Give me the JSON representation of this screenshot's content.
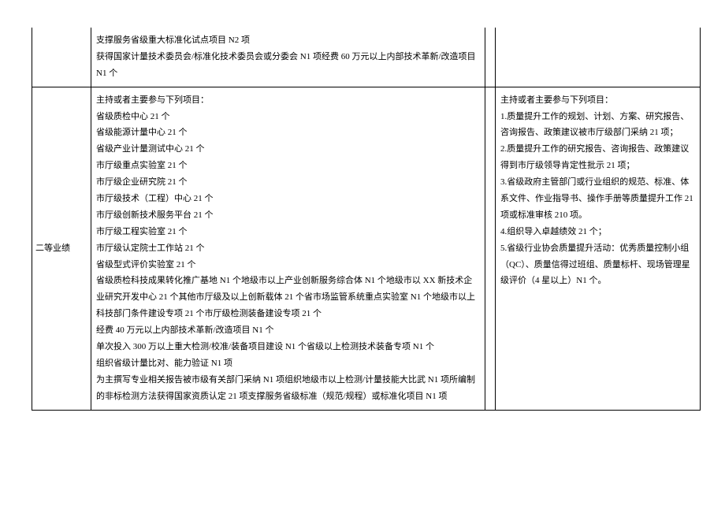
{
  "top_row": {
    "lines": [
      "支撑服务省级重大标准化试点项目 N2 项",
      "获得国家计量技术委员会/标准化技术委员会或分委会 N1 项经费 60 万元以上内部技术革新/改造项目N1 个"
    ]
  },
  "main_row": {
    "label": "二等业绩",
    "left_lines": [
      "主持或者主要参与下列项目：",
      "省级质检中心 21 个",
      "省级能源计量中心 21 个",
      "省级产业计量测试中心 21 个",
      "市厅级重点实验室 21 个",
      "市厅级企业研究院 21 个",
      "市厅级技术（工程）中心 21 个",
      "市厅级创新技术服务平台 21 个",
      "市厅级工程实验室 21 个",
      "市厅级认定院士工作站 21 个",
      "省级型式评价实验室 21 个",
      "省级质检科技成果转化推广基地 N1 个地级市以上产业创新服务综合体 N1 个地级市以 XX 新技术企业研究开发中心 21 个其他市厅级及以上创新载体 21 个省市场监管系统重点实验室 N1 个地级市以上科技部门条件建设专项 21 个市厅级检测装备建设专项 21 个",
      "经费 40 万元以上内部技术革新/改造项目 N1 个",
      "单次投入 300 万以上重大检测/校准/装备项目建设 N1 个省级以上检测技术装备专项 N1 个",
      "组织省级计量比对、能力验证 N1 项",
      "为主撰写专业相关报告被市级有关部门采纳 N1 项组织地级市以上检测/计量技能大比武 N1 项所编制的非标检测方法获得国家资质认定 21 项支撑服务省级标准（规范/规程）或标准化项目 N1 项"
    ],
    "right_lines": [
      "主持或者主要参与下列项目：",
      "1.质量提升工作的规划、计划、方案、研究报告、咨询报告、政策建议被市厅级部门采纳 21 项；",
      "2.质量提升工作的研究报告、咨询报告、政策建议得到市厅级领导肯定性批示 21 项；",
      "3.省级政府主管部门或行业组织的规范、标准、体系文件、作业指导书、操作手册等质量提升工作 21 项或标准审核 210 项。",
      "4.组织导入卓越绩效 21 个；",
      "5.省级行业协会质量提升活动：优秀质量控制小组（QC）、质量信得过班组、质量标杆、现场管理星级评价（4 星以上）N1 个。"
    ]
  }
}
